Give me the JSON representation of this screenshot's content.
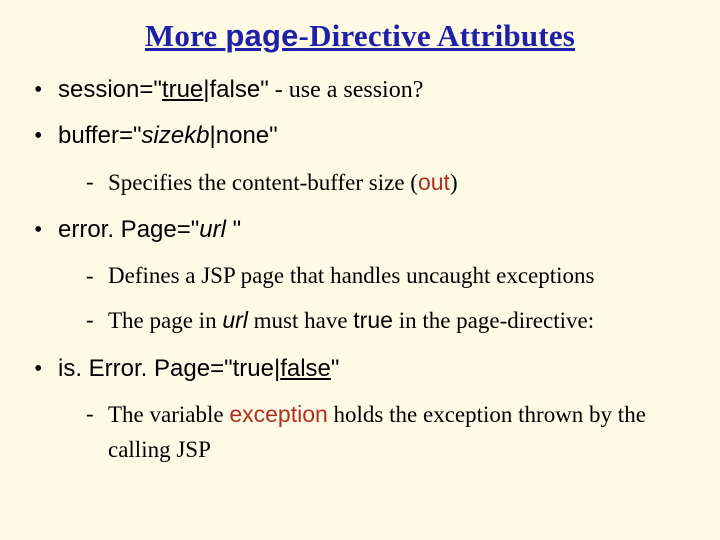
{
  "title_parts": {
    "pre": "More ",
    "code": "page",
    "post": "-Directive Attributes"
  },
  "b1": {
    "attr": "session",
    "eq": "=\"",
    "val_true": "true",
    "pipe": "|",
    "val_false": "false\"",
    "tail": " - use a session?"
  },
  "b2": {
    "attr": "buffer",
    "eq": "=\"",
    "val_size": "sizekb",
    "pipe": "|",
    "val_none": "none\"",
    "sub1_a": " Specifies the content-buffer size (",
    "sub1_out": "out",
    "sub1_b": ")"
  },
  "b3": {
    "attr": "error. Page",
    "eq": "=\"",
    "val_url": "url ",
    "close": "\"",
    "sub1": "Defines a JSP page that handles uncaught exceptions",
    "sub2_a": "The page in ",
    "sub2_url": "url",
    "sub2_b": " must have ",
    "sub2_true": "true",
    "sub2_c": " in the page-directive:"
  },
  "b4": {
    "attr": "is. Error. Page",
    "eq": "=\"",
    "val_true": "true",
    "pipe": "|",
    "val_false": "false",
    "close": "\"",
    "sub1_a": "The variable ",
    "sub1_ex": "exception",
    "sub1_b": " holds the exception thrown by the calling JSP"
  }
}
